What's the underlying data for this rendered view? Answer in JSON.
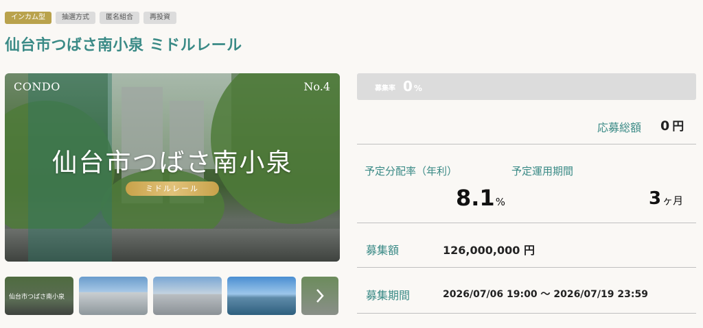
{
  "tags": [
    "インカム型",
    "抽選方式",
    "匿名組合",
    "再投資"
  ],
  "title": "仙台市つばさ南小泉 ミドルレール",
  "hero": {
    "brand": "CONDO",
    "number": "No.4",
    "name": "仙台市つばさ南小泉",
    "badge": "ミドルレール"
  },
  "thumbnails": [
    {
      "caption": "仙台市つばさ南小泉"
    },
    {
      "caption": ""
    },
    {
      "caption": ""
    },
    {
      "caption": ""
    },
    {
      "caption": ""
    }
  ],
  "next_icon": "chevron-right-icon",
  "recruitment": {
    "rate_label": "募集率",
    "rate_value": "0",
    "rate_unit": "%",
    "total_label": "応募総額",
    "total_value": "0",
    "total_unit": "円"
  },
  "terms": {
    "distribution_label": "予定分配率（年利）",
    "distribution_value": "8.1",
    "distribution_unit": "%",
    "period_label": "予定運用期間",
    "period_value": "3",
    "period_unit": "ヶ月"
  },
  "amount": {
    "label": "募集額",
    "value": "126,000,000",
    "unit": "円"
  },
  "schedule": {
    "label": "募集期間",
    "value": "2026/07/06 19:00 〜 2026/07/19 23:59"
  },
  "colors": {
    "accent_teal": "#3a8a86",
    "tag_gold": "#b9a24c",
    "badge_gold": "#c8a24a",
    "rate_bar": "#dcdcdc"
  }
}
